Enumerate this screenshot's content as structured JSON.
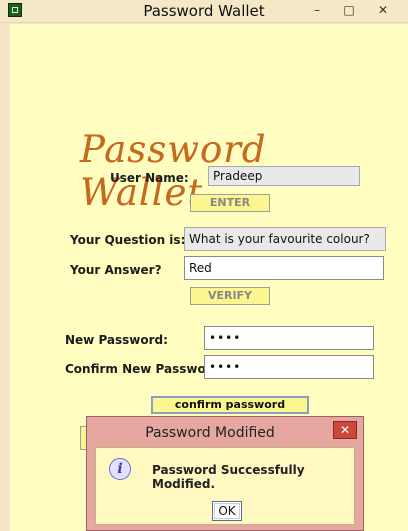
{
  "window": {
    "title": "Password Wallet",
    "minimize": "–",
    "maximize": "□",
    "close": "✕"
  },
  "brand": "Password Wallet",
  "form": {
    "username_label": "User Name:",
    "username_value": "Pradeep",
    "enter_button": "ENTER",
    "question_label": "Your Question is:",
    "question_value": "What is your favourite colour?",
    "answer_label": "Your Answer?",
    "answer_value": "Red",
    "verify_button": "VERIFY",
    "new_password_label": "New Password:",
    "new_password_value": "••••",
    "confirm_password_label": "Confirm New Password:",
    "confirm_password_value": "••••",
    "confirm_button": "confirm password"
  },
  "dialog": {
    "title": "Password Modified",
    "message": "Password Successfully Modified.",
    "ok_button": "OK",
    "icon": "info-icon",
    "close_glyph": "✕"
  }
}
